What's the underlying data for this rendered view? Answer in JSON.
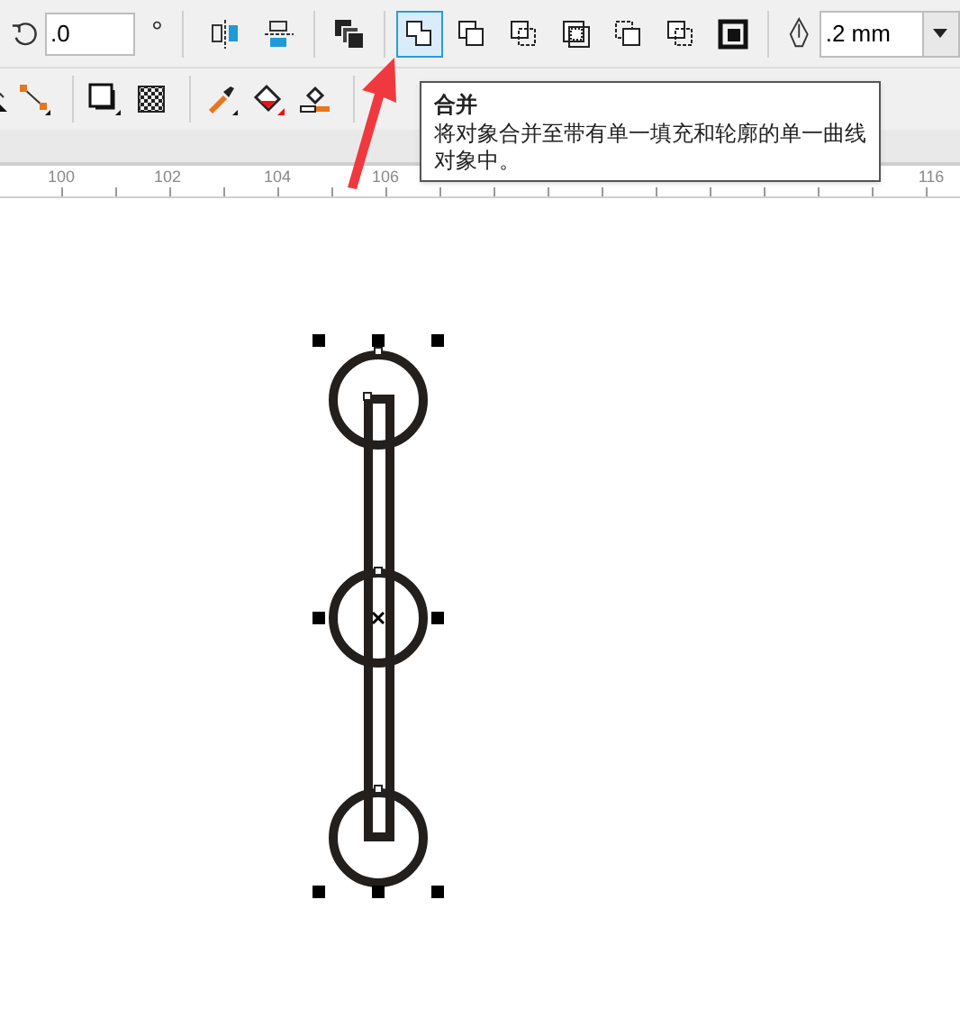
{
  "toolbar": {
    "angle_field": {
      "value": ".0"
    },
    "degree_sign": "°",
    "buttons": [
      {
        "kind": "mirror-h",
        "selected": false
      },
      {
        "kind": "mirror-v",
        "selected": false
      },
      {
        "kind": "group",
        "selected": false
      },
      {
        "kind": "combine",
        "selected": true
      },
      {
        "kind": "weld",
        "selected": false
      },
      {
        "kind": "trim",
        "selected": false
      },
      {
        "kind": "intersect",
        "selected": false
      },
      {
        "kind": "simplify",
        "selected": false
      },
      {
        "kind": "front-minus-back",
        "selected": false
      },
      {
        "kind": "boundary",
        "selected": false
      }
    ],
    "outline_width": {
      "value": ".2 mm"
    }
  },
  "toolbar_2": {
    "buttons": [
      {
        "kind": "shape"
      },
      {
        "kind": "connector"
      },
      {
        "kind": "shadow"
      },
      {
        "kind": "transparency"
      },
      {
        "kind": "eyedropper"
      },
      {
        "kind": "fill"
      },
      {
        "kind": "smart-fill"
      }
    ]
  },
  "tooltip": {
    "title": "合并",
    "description": "将对象合并至带有单一填充和轮廓的单一曲线对象中。"
  },
  "ruler": {
    "labels": [
      "100",
      "102",
      "104",
      "106",
      "116"
    ]
  }
}
